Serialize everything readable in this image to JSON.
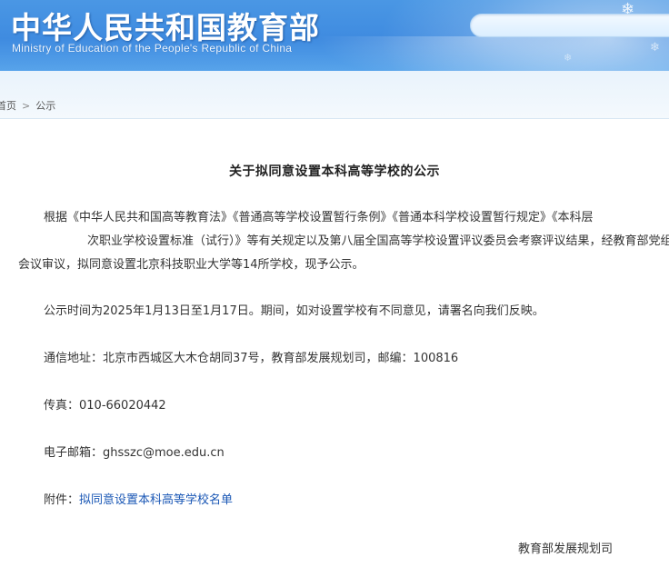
{
  "header": {
    "title": "中华人民共和国教育部",
    "subtitle": "Ministry of Education of the People's Republic of China",
    "search": {
      "placeholder": ""
    },
    "icons": [
      "snowflake-icon",
      "search-box"
    ]
  },
  "breadcrumb": {
    "items": [
      "首页",
      "公示"
    ],
    "separator": ">"
  },
  "article": {
    "title": "关于拟同意设置本科高等学校的公示",
    "body_lines": [
      "根据《中华人民共和国高等教育法》《普通高等学校设置暂行条例》《普通本科学校设置暂行规定》《本科层",
      "次职业学校设置标准（试行）》等有关规定以及第八届全国高等学校设置评议委员会考察评议结果，经教育部党组",
      "会议审议，拟同意设置北京科技职业大学等14所学校，现予公示。"
    ],
    "period": "公示时间为2025年1月13日至1月17日。期间，如对设置学校有不同意见，请署名向我们反映。",
    "address": "通信地址：北京市西城区大木仓胡同37号，教育部发展规划司，邮编：100816",
    "fax": "传真：010-66020442",
    "email": "电子邮箱：ghsszc@moe.edu.cn",
    "attachment_label": "附件：",
    "attachment_link": "拟同意设置本科高等学校名单",
    "signature": "教育部发展规划司"
  },
  "colors": {
    "header_blue": "#3f8be0",
    "link_blue": "#1a57b5",
    "breadcrumb_bg": "#e9f3fc"
  }
}
